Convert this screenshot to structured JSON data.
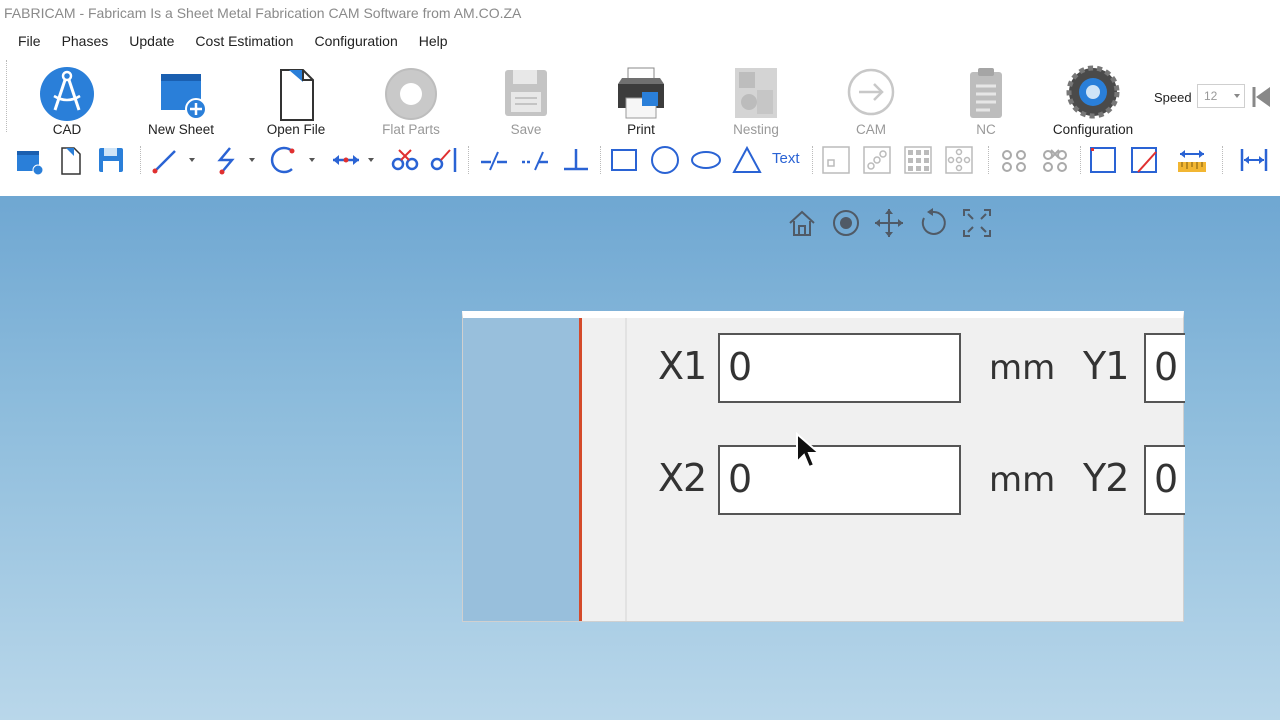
{
  "window": {
    "title": "FABRICAM - Fabricam Is a Sheet Metal Fabrication CAM Software from AM.CO.ZA"
  },
  "menu": [
    "File",
    "Phases",
    "Update",
    "Cost Estimation",
    "Configuration",
    "Help"
  ],
  "ribbon": {
    "buttons": [
      {
        "label": "CAD",
        "icon": "cad-compass-icon",
        "enabled": true
      },
      {
        "label": "New Sheet",
        "icon": "new-sheet-icon",
        "enabled": true
      },
      {
        "label": "Open File",
        "icon": "open-file-icon",
        "enabled": true
      },
      {
        "label": "Flat Parts",
        "icon": "flat-parts-icon",
        "enabled": false
      },
      {
        "label": "Save",
        "icon": "save-icon",
        "enabled": false
      },
      {
        "label": "Print",
        "icon": "printer-icon",
        "enabled": true
      },
      {
        "label": "Nesting",
        "icon": "nesting-icon",
        "enabled": false
      },
      {
        "label": "CAM",
        "icon": "cam-arrow-icon",
        "enabled": false
      },
      {
        "label": "NC",
        "icon": "nc-clipboard-icon",
        "enabled": false
      },
      {
        "label": "Configuration",
        "icon": "configuration-gear-icon",
        "enabled": true
      }
    ],
    "speed_label": "Speed",
    "speed_value": "12"
  },
  "toolbar": {
    "text_tool_label": "Text"
  },
  "dialog": {
    "x1_label": "X1",
    "x1_value": "0",
    "x2_label": "X2",
    "x2_value": "0",
    "y1_label": "Y1",
    "y1_value": "0",
    "y2_label": "Y2",
    "y2_value": "0",
    "unit": "mm"
  },
  "colors": {
    "accent_blue": "#2a7fd9",
    "canvas_top": "#6fa7d2",
    "canvas_bottom": "#b9d7ea",
    "dialog_bg": "#f0f0f0",
    "red_line": "#d44a2a"
  }
}
